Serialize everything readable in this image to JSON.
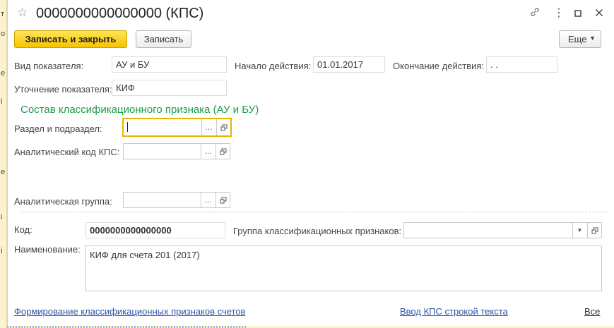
{
  "window": {
    "title": "0000000000000000 (КПС)"
  },
  "toolbar": {
    "save_close_label": "Записать и закрыть",
    "save_label": "Записать",
    "more_label": "Еще"
  },
  "form": {
    "indicator_type": {
      "label": "Вид показателя:",
      "value": "АУ и БУ"
    },
    "start_date": {
      "label": "Начало действия:",
      "value": "01.01.2017"
    },
    "end_date": {
      "label": "Окончание действия:",
      "value": " .  ."
    },
    "indicator_refinement": {
      "label": "Уточнение показателя:",
      "value": "КИФ"
    },
    "section_title": "Состав классификационного признака (АУ и БУ)",
    "section_subsection": {
      "label": "Раздел и подраздел:",
      "value": ""
    },
    "analytic_code": {
      "label": "Аналитический код КПС:",
      "value": ""
    },
    "analytic_group": {
      "label": "Аналитическая группа:",
      "value": ""
    },
    "code": {
      "label": "Код:",
      "value": "0000000000000000"
    },
    "class_group": {
      "label": "Группа классификационных признаков:",
      "value": ""
    },
    "name": {
      "label": "Наименование:",
      "value": "КИФ для счета 201 (2017)"
    }
  },
  "footer": {
    "link_forming": "Формирование классификационных признаков счетов",
    "link_text_input": "Ввод КПС строкой текста",
    "link_all": "Все"
  },
  "icons": {
    "star": "star-icon",
    "link": "link-icon",
    "menu": "more-vert-icon",
    "maximize": "maximize-icon",
    "close": "close-icon"
  }
}
